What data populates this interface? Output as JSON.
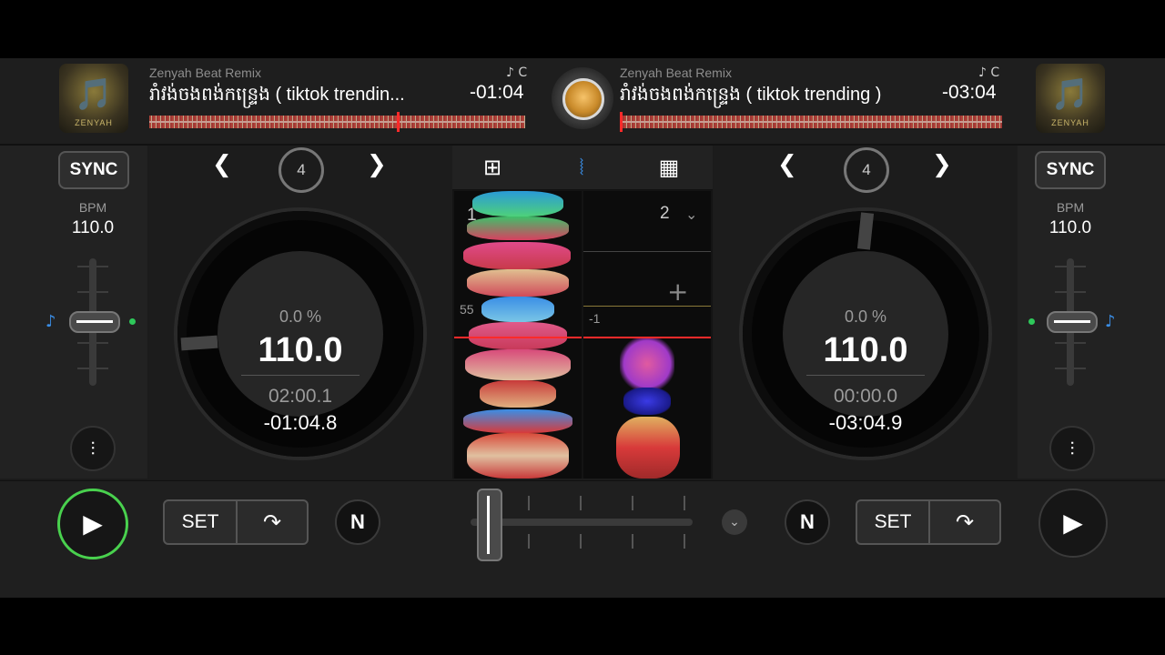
{
  "deck_left": {
    "artist": "Zenyah Beat Remix",
    "title": "រាំវង់ចងពង់កន្ទ្រេង ( tiktok trendin...",
    "key": "♪ C",
    "remaining_header": "-01:04",
    "sync_label": "SYNC",
    "bpm_label": "BPM",
    "bpm_value": "110.0",
    "loop_beats": "4",
    "pitch": "0.0 %",
    "bpm_big": "110.0",
    "elapsed": "02:00.1",
    "remaining": "-01:04.8",
    "cover_caption": "ZENYAH"
  },
  "deck_right": {
    "artist": "Zenyah Beat Remix",
    "title": "រាំវង់ចងពង់កន្ទ្រេង ( tiktok trending )",
    "key": "♪ C",
    "remaining_header": "-03:04",
    "sync_label": "SYNC",
    "bpm_label": "BPM",
    "bpm_value": "110.0",
    "loop_beats": "4",
    "pitch": "0.0 %",
    "bpm_big": "110.0",
    "elapsed": "00:00.0",
    "remaining": "-03:04.9",
    "cover_caption": "ZENYAH"
  },
  "center": {
    "beat_left": "1",
    "beat_right": "2",
    "marker_55": "55",
    "marker_neg1": "-1"
  },
  "bottom": {
    "set_label": "SET",
    "n_label": "N"
  },
  "icons": {
    "play": "▶",
    "prev": "❮",
    "next": "❯",
    "note": "♪",
    "mixer": "⫶",
    "chevron_down": "⌄",
    "cue_jump": "↷",
    "plus": "+"
  },
  "colors": {
    "accent_blue": "#3a8ee6",
    "play_active_green": "#49d14e",
    "playhead_red": "#ff2a2a"
  }
}
